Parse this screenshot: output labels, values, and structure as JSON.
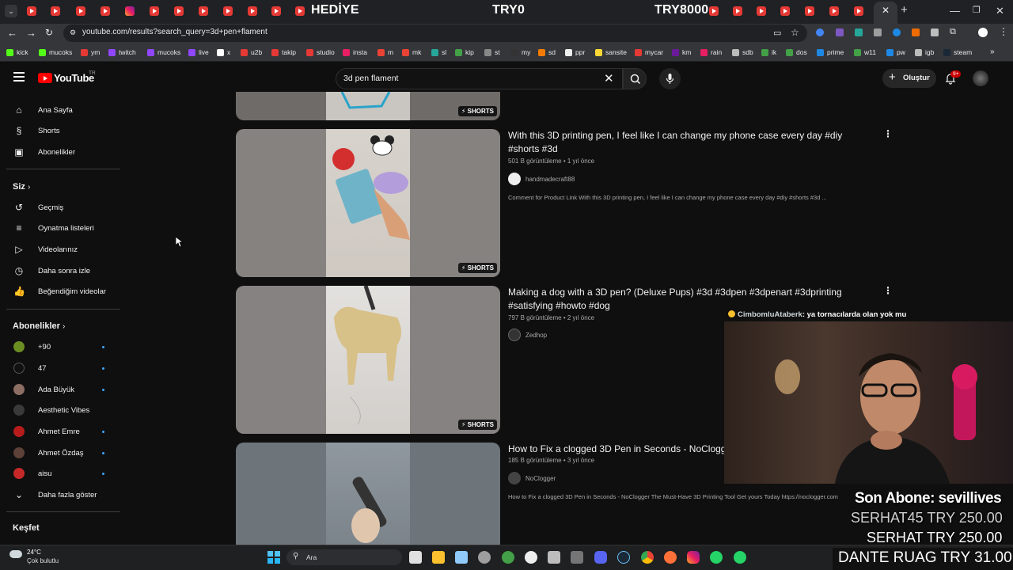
{
  "overlay_titles": {
    "left": "HEDİYE",
    "center": "TRY0",
    "right": "TRY8000"
  },
  "url": "youtube.com/results?search_query=3d+pen+flament",
  "bookmarks": [
    "kick",
    "mucoks",
    "ym",
    "twitch",
    "mucoks",
    "live",
    "x",
    "u2b",
    "takip",
    "studio",
    "insta",
    "m",
    "mk",
    "sl",
    "kip",
    "st",
    "my",
    "sd",
    "ppr",
    "sansite",
    "mycar",
    "km",
    "rain",
    "sdb",
    "ik",
    "dos",
    "prime",
    "w11",
    "pw",
    "igb",
    "steam"
  ],
  "youtube": {
    "logo": "YouTube",
    "region": "TR",
    "search_value": "3d pen flament",
    "create_label": "Oluştur",
    "notif_count": "9+"
  },
  "sidebar": {
    "main": [
      {
        "label": "Ana Sayfa",
        "icon": "home-icon"
      },
      {
        "label": "Shorts",
        "icon": "shorts-icon"
      },
      {
        "label": "Abonelikler",
        "icon": "subscriptions-icon"
      }
    ],
    "you_header": "Siz",
    "you": [
      {
        "label": "Geçmiş",
        "icon": "history-icon"
      },
      {
        "label": "Oynatma listeleri",
        "icon": "playlists-icon"
      },
      {
        "label": "Videolarınız",
        "icon": "your-videos-icon"
      },
      {
        "label": "Daha sonra izle",
        "icon": "watch-later-icon"
      },
      {
        "label": "Beğendiğim videolar",
        "icon": "liked-icon"
      }
    ],
    "subs_header": "Abonelikler",
    "subs": [
      {
        "label": "+90",
        "color": "#6b8e23",
        "new": true
      },
      {
        "label": "47",
        "color": "#111111",
        "new": true
      },
      {
        "label": "Ada Büyük",
        "color": "#8d6e63",
        "new": true
      },
      {
        "label": "Aesthetic Vibes",
        "color": "#3a3a3a",
        "new": false
      },
      {
        "label": "Ahmet Emre",
        "color": "#b71c1c",
        "new": true
      },
      {
        "label": "Ahmet Özdaş",
        "color": "#5d4037",
        "new": true
      },
      {
        "label": "aisu",
        "color": "#c62828",
        "new": true
      }
    ],
    "show_more": "Daha fazla göster",
    "explore_header": "Keşfet"
  },
  "results": [
    {
      "title_line1": "With this 3D printing pen, I feel like I can change my phone case every day #diy",
      "title_line2": "#shorts #3d",
      "meta": "501 B görüntüleme • 1 yıl önce",
      "channel": "handmadecraft88",
      "desc": "Comment for Product Link With this 3D printing pen, I feel like I can change my phone case every day #diy #shorts #3d ...",
      "badge": "SHORTS"
    },
    {
      "title_line1": "Making a dog with a 3D pen? (Deluxe Pups) #3d #3dpen #3dpenart #3dprinting",
      "title_line2": "#satisfying #howto #dog",
      "meta": "797 B görüntüleme • 2 yıl önce",
      "channel": "Zedhop",
      "badge": "SHORTS"
    },
    {
      "title_line1": "How to Fix a clogged 3D Pen in Seconds - NoClogger",
      "meta": "185 B görüntüleme • 3 yıl önce",
      "channel": "NoClogger",
      "desc": "How to Fix a clogged 3D Pen in Seconds - NoClogger The Must-Have 3D Printing Tool Get yours Today https://noclogger.com"
    }
  ],
  "top_badge": "SHORTS",
  "stream": {
    "chat_user": "CimbomluAtaberk",
    "chat_msg": ": ya tornacılarda olan yok mu",
    "last_sub_label": "Son Abone: sevillives",
    "donations": [
      "SERHAT45  TRY 250.00",
      "SERHAT  TRY 250.00",
      "DANTE RUAG  TRY 31.00"
    ]
  },
  "taskbar": {
    "weather_temp": "24°C",
    "weather_desc": "Çok bulutlu",
    "search": "Ara"
  }
}
